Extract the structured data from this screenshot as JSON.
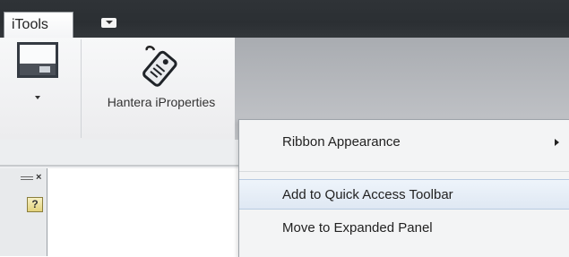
{
  "tabs": {
    "itools_label": "iTools",
    "dropdown_icon": "dropdown-arrow-icon"
  },
  "ribbon": {
    "big_button_icon": "display-settings-icon",
    "hantera_label": "Hantera iProperties",
    "hantera_icon": "tag-icon"
  },
  "panel": {
    "help_label": "?",
    "close_label": "×"
  },
  "context_menu": {
    "items": [
      {
        "label": "Ribbon Appearance",
        "has_submenu": true
      },
      {
        "label": "Add to Quick Access Toolbar",
        "highlighted": true
      },
      {
        "label": "Move to Expanded Panel"
      }
    ]
  },
  "colors": {
    "topbar": "#2f3337",
    "highlight": "#dfe8f3"
  }
}
